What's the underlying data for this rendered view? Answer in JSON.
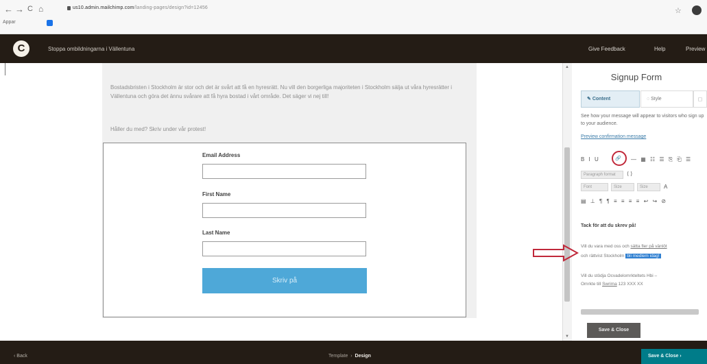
{
  "browser": {
    "back": "←",
    "forward": "→",
    "reload": "C",
    "home": "⌂",
    "url_host": "us10.admin.mailchimp.com",
    "url_path": "/landing-pages/design?id=12456",
    "apps_label": "Appar",
    "star": "☆"
  },
  "header": {
    "logo": "C",
    "breadcrumb": "Stoppa ombildningarna i Vällentuna",
    "links": [
      "Give Feedback",
      "Help",
      "Preview"
    ]
  },
  "canvas": {
    "paragraph_1": "Bostadsbristen i Stockholm är stor och det är svårt att få en hyresrätt. Nu vill den borgerliga majoriteten i Stockholm sälja ut våra hyresrätter i Vällentuna och göra det ännu svårare att få hyra bostad i vårt område. Det säger vi nej till!",
    "paragraph_2": "Håller du med? Skriv under vår protest!",
    "form": {
      "email_label": "Email Address",
      "first_name_label": "First Name",
      "last_name_label": "Last Name",
      "submit_label": "Skriv på"
    }
  },
  "panel": {
    "title": "Signup Form",
    "tabs": {
      "content": "Content",
      "style": "Style",
      "extra": "◻"
    },
    "description": "See how your message will appear to visitors who sign up to your audience.",
    "preview_link": "Preview confirmation message",
    "toolbar": {
      "row1_before": "B I U",
      "link_button": "🔗",
      "row1_after": "— ▦ ☷ ☰ ⎘ ⎗ ☰",
      "paragraph_select": "Paragraph format",
      "source": "⟨⟩",
      "font_select": "Font",
      "size_select": "Size",
      "color_btn": "A",
      "row4": "▤ ⊥ ¶ ¶ ≡ ≡ ≡ ≡ ↩ ↪ ⊘"
    },
    "editor": {
      "heading": "Tack för att du skrev på!",
      "line1_a": "Vill du vara med oss och ",
      "line1_link": "sätta fler på vänlöt",
      "line2_a": "och rättvist Stockholm ",
      "line2_highlight": "bli medlem idag!",
      "line3": "Vill du stödja Ocvadelomrkteltets Hbi –",
      "line4_a": "Omrkte till ",
      "line4_link": "Swrima",
      "line4_b": " 123 XXX XX"
    },
    "save_close": "Save & Close"
  },
  "footer": {
    "back": "‹ Back",
    "step_template": "Template",
    "step_sep": "›",
    "step_design": "Design",
    "save_close": "Save & Close  ›"
  },
  "colors": {
    "header_bg": "#241c15",
    "submit_button": "#4ea8d8",
    "annotation_red": "#c0283a",
    "footer_save": "#007c89",
    "selection_highlight": "#2f7fd1"
  }
}
